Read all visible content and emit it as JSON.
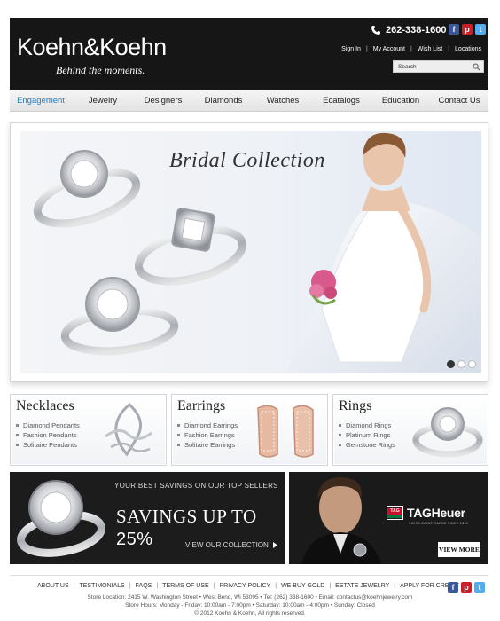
{
  "header": {
    "logo": "Koehn&Koehn",
    "tagline": "Behind the moments.",
    "phone": "262-338-1600",
    "account_links": [
      "Sign In",
      "My Account",
      "Wish List",
      "Locations"
    ],
    "search_placeholder": "Search"
  },
  "nav": {
    "items": [
      "Engagement",
      "Jewelry",
      "Designers",
      "Diamonds",
      "Watches",
      "Ecatalogs",
      "Education",
      "Contact Us"
    ],
    "active": "Engagement",
    "active_color": "#2a7ab5"
  },
  "banner": {
    "title": "Bridal Collection",
    "slides": 3,
    "current_slide": 1
  },
  "categories": [
    {
      "title": "Necklaces",
      "items": [
        "Diamond Pendants",
        "Fashion Pendants",
        "Solitaire Pendants"
      ]
    },
    {
      "title": "Earrings",
      "items": [
        "Diamond Earrings",
        "Fashion Earrings",
        "Solitaire Earrings"
      ]
    },
    {
      "title": "Rings",
      "items": [
        "Diamond Rings",
        "Platinum Rings",
        "Gemstone Rings"
      ]
    }
  ],
  "promo": {
    "top_text": "YOUR BEST SAVINGS ON OUR TOP SELLERS",
    "big_text": "SAVINGS UP TO",
    "percent": "25%",
    "link": "VIEW OUR COLLECTION"
  },
  "tag_heuer": {
    "logo_text": "TAG",
    "brand": "TAGHeuer",
    "sub": "SWISS AVANT-GARDE SINCE 1860",
    "button": "VIEW MORE"
  },
  "footer": {
    "links": [
      "ABOUT US",
      "TESTIMONIALS",
      "FAQS",
      "TERMS OF USE",
      "PRIVACY POLICY",
      "WE BUY GOLD",
      "ESTATE JEWELRY",
      "APPLY FOR CREDIT"
    ],
    "address": "Store Location: 2415 W. Washington Street • West Bend, Wi 53095 • Tel: (262) 338-1600 • Email: contactus@koehnjewelry.com",
    "hours": "Store Hours: Monday - Friday: 10:00am - 7:00pm • Saturday: 10:00am - 4:00pm • Sunday: Closed",
    "copyright": "© 2012 Koehn & Koehn, All rights reserved."
  },
  "icons": [
    "facebook-icon",
    "pinterest-icon",
    "twitter-icon",
    "phone-icon",
    "search-icon",
    "arrow-right-icon"
  ]
}
